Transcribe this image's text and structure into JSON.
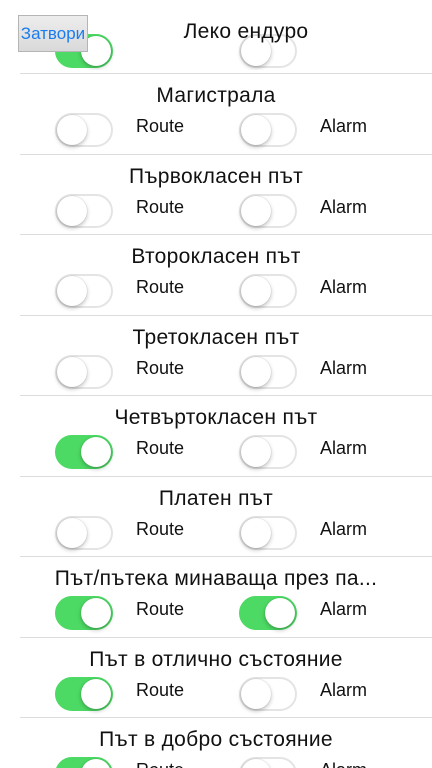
{
  "header": {
    "close_label": "Затвори",
    "title": "Леко ендуро",
    "partial_row": {
      "route_on": true,
      "alarm_on": false
    }
  },
  "labels": {
    "route": "Route",
    "alarm": "Alarm"
  },
  "colors": {
    "toggle_on": "#4cd964",
    "button_text": "#1a7cf0"
  },
  "rows": [
    {
      "title": "Магистрала",
      "route_on": false,
      "alarm_on": false
    },
    {
      "title": "Първокласен път",
      "route_on": false,
      "alarm_on": false
    },
    {
      "title": "Второкласен път",
      "route_on": false,
      "alarm_on": false
    },
    {
      "title": "Третокласен път",
      "route_on": false,
      "alarm_on": false
    },
    {
      "title": "Четвъртокласен път",
      "route_on": true,
      "alarm_on": false
    },
    {
      "title": "Платен път",
      "route_on": false,
      "alarm_on": false
    },
    {
      "title": "Път/пътека минаваща през па...",
      "route_on": true,
      "alarm_on": true
    },
    {
      "title": "Път в отлично състояние",
      "route_on": true,
      "alarm_on": false
    },
    {
      "title": "Път в добро състояние",
      "route_on": true,
      "alarm_on": false
    }
  ]
}
